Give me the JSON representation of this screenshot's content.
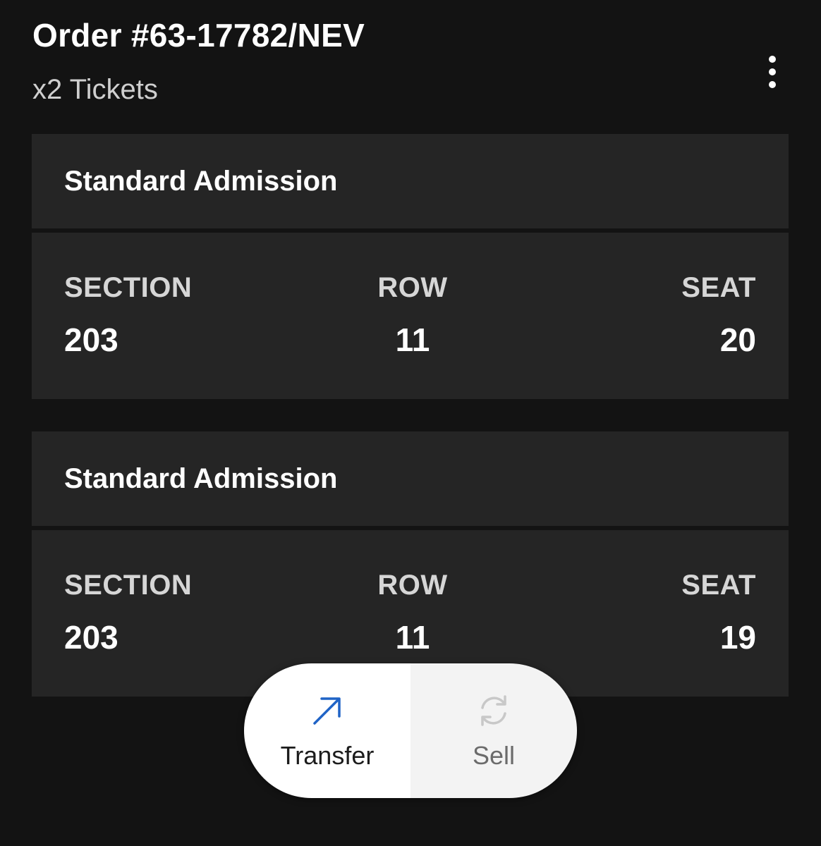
{
  "header": {
    "order_title": "Order #63-17782/NEV",
    "ticket_count": "x2 Tickets",
    "more_icon": "more-vertical-icon"
  },
  "tickets": [
    {
      "type": "Standard Admission",
      "section_label": "SECTION",
      "section": "203",
      "row_label": "ROW",
      "row": "11",
      "seat_label": "SEAT",
      "seat": "20"
    },
    {
      "type": "Standard Admission",
      "section_label": "SECTION",
      "section": "203",
      "row_label": "ROW",
      "row": "11",
      "seat_label": "SEAT",
      "seat": "19"
    }
  ],
  "actions": {
    "transfer": {
      "label": "Transfer",
      "icon": "arrow-up-right-icon",
      "color": "#1f63c6"
    },
    "sell": {
      "label": "Sell",
      "icon": "refresh-icon",
      "color": "#c8c8c8"
    }
  },
  "colors": {
    "background": "#131313",
    "card": "#252525"
  }
}
